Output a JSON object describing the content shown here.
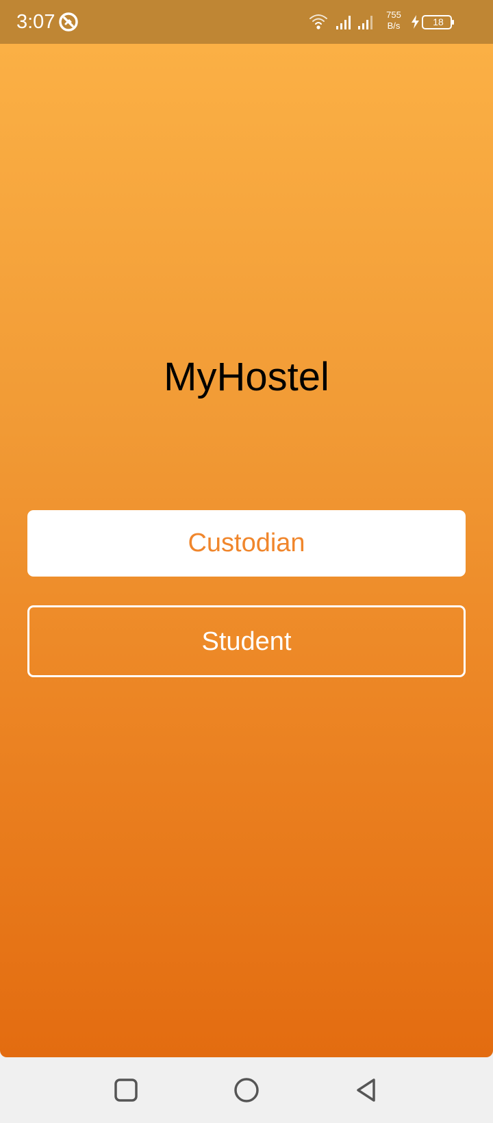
{
  "status_bar": {
    "time": "3:07",
    "net_speed_value": "755",
    "net_speed_unit": "B/s",
    "battery_level": "18",
    "icons": [
      "vpn-icon",
      "wifi-icon",
      "signal-icon",
      "signal-icon",
      "charging-icon",
      "battery-icon"
    ]
  },
  "app": {
    "title": "MyHostel",
    "custodian_label": "Custodian",
    "student_label": "Student",
    "colors": {
      "gradient_top": "#fbb045",
      "gradient_bottom": "#e36c10",
      "accent_text": "#f0862c",
      "status_bar": "#bf8634"
    }
  },
  "nav_bar": {
    "icons": [
      "recents-icon",
      "home-icon",
      "back-icon"
    ]
  }
}
